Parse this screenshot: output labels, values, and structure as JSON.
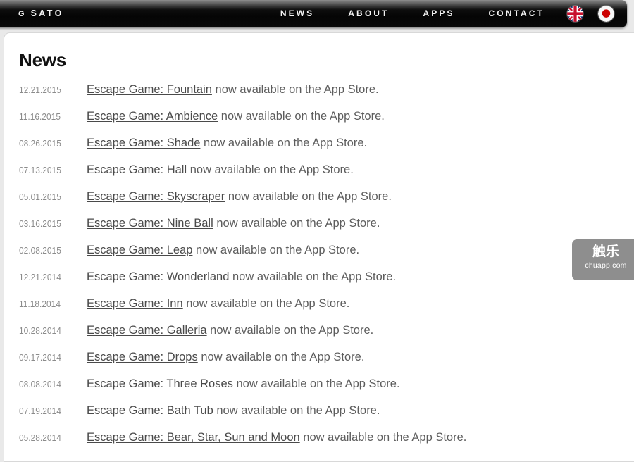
{
  "header": {
    "brand_prefix": "G",
    "brand_name": "SATO",
    "nav": [
      {
        "label": "NEWS",
        "name": "nav-news"
      },
      {
        "label": "ABOUT",
        "name": "nav-about"
      },
      {
        "label": "APPS",
        "name": "nav-apps"
      },
      {
        "label": "CONTACT",
        "name": "nav-contact"
      }
    ],
    "language_flags": [
      {
        "icon": "uk-flag-icon",
        "name": "language-english"
      },
      {
        "icon": "japan-flag-icon",
        "name": "language-japanese"
      }
    ]
  },
  "main": {
    "title": "News",
    "news": [
      {
        "date": "12.21.2015",
        "link": "Escape Game: Fountain",
        "suffix": " now available on the App Store."
      },
      {
        "date": "11.16.2015",
        "link": "Escape Game: Ambience",
        "suffix": " now available on the App Store."
      },
      {
        "date": "08.26.2015",
        "link": "Escape Game: Shade",
        "suffix": " now available on the App Store."
      },
      {
        "date": "07.13.2015",
        "link": "Escape Game: Hall",
        "suffix": " now available on the App Store."
      },
      {
        "date": "05.01.2015",
        "link": "Escape Game: Skyscraper",
        "suffix": " now available on the App Store."
      },
      {
        "date": "03.16.2015",
        "link": "Escape Game: Nine Ball",
        "suffix": " now available on the App Store."
      },
      {
        "date": "02.08.2015",
        "link": "Escape Game: Leap",
        "suffix": " now available on the App Store."
      },
      {
        "date": "12.21.2014",
        "link": "Escape Game: Wonderland",
        "suffix": " now available on the App Store."
      },
      {
        "date": "11.18.2014",
        "link": "Escape Game: Inn",
        "suffix": " now available on the App Store."
      },
      {
        "date": "10.28.2014",
        "link": "Escape Game: Galleria",
        "suffix": " now available on the App Store."
      },
      {
        "date": "09.17.2014",
        "link": "Escape Game: Drops",
        "suffix": " now available on the App Store."
      },
      {
        "date": "08.08.2014",
        "link": "Escape Game: Three Roses",
        "suffix": " now available on the App Store."
      },
      {
        "date": "07.19.2014",
        "link": "Escape Game: Bath Tub",
        "suffix": " now available on the App Store."
      },
      {
        "date": "05.28.2014",
        "link": "Escape Game: Bear, Star, Sun and Moon",
        "suffix": " now available on the App Store."
      }
    ]
  },
  "watermark": {
    "cn_text": "触乐",
    "url_text": "chuapp.com"
  },
  "colors": {
    "page_background": "#e9e9e9",
    "header_dark": "#080808",
    "panel_background": "#ffffff",
    "date_text": "#8b8b8b",
    "body_text": "#5d5d5d",
    "link_text": "#4a4a4a",
    "watermark_background": "#8e8e8e",
    "japan_red": "#cc0000"
  }
}
